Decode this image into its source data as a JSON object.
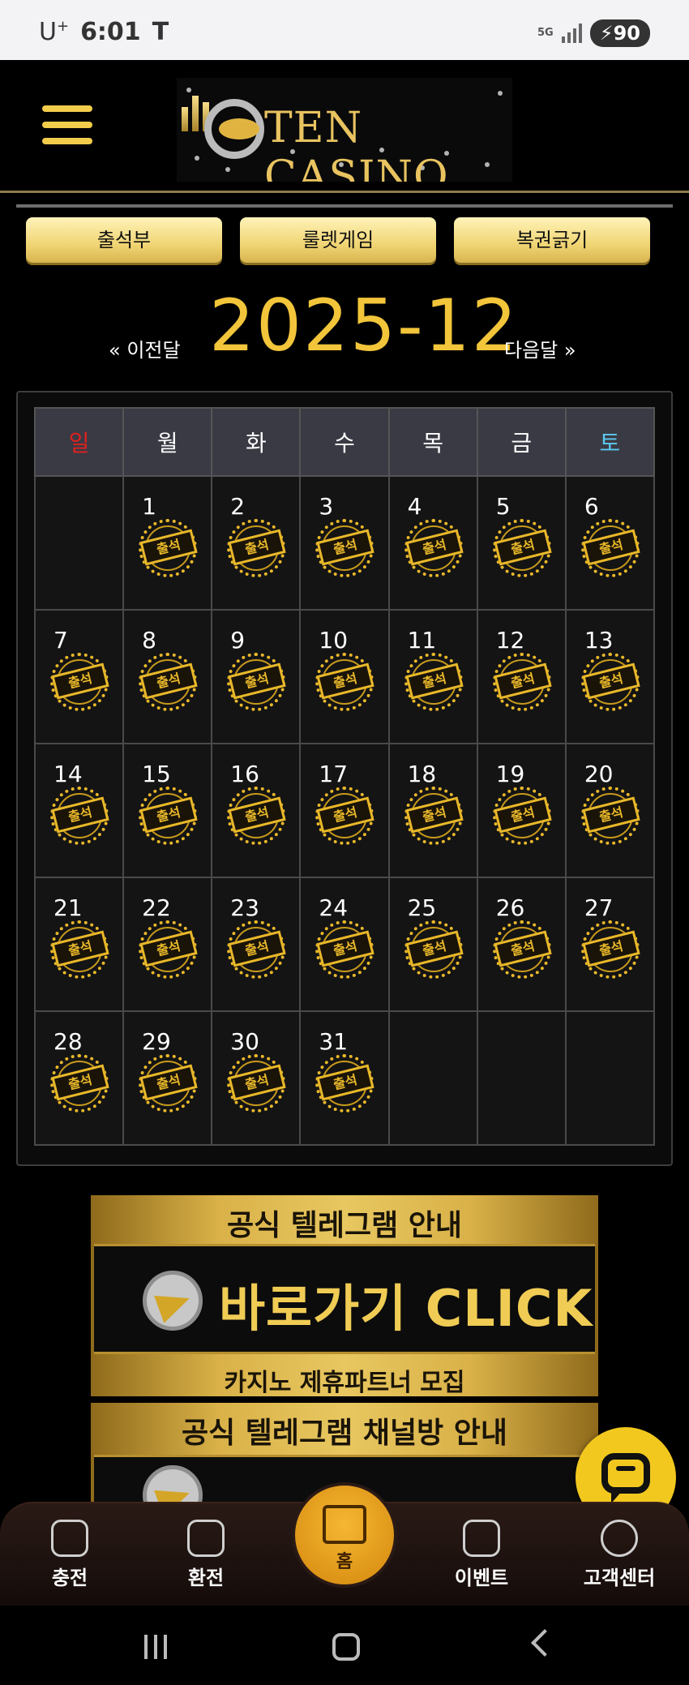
{
  "statusbar": {
    "carrier": "U",
    "carrier_sup": "+",
    "time": "6:01",
    "t_icon": "T",
    "network": "5G",
    "battery": "90"
  },
  "header": {
    "logo_text": "TEN CASINO",
    "menu_icon": "hamburger-icon"
  },
  "top_buttons": [
    "출석부",
    "룰렛게임",
    "복권긁기"
  ],
  "calendar": {
    "prev_label": "« 이전달",
    "month": "2025-12",
    "next_label": "다음달 »",
    "weekdays": [
      "일",
      "월",
      "화",
      "수",
      "목",
      "금",
      "토"
    ],
    "stamp_label": "출석",
    "weeks": [
      [
        "",
        "1",
        "2",
        "3",
        "4",
        "5",
        "6"
      ],
      [
        "7",
        "8",
        "9",
        "10",
        "11",
        "12",
        "13"
      ],
      [
        "14",
        "15",
        "16",
        "17",
        "18",
        "19",
        "20"
      ],
      [
        "21",
        "22",
        "23",
        "24",
        "25",
        "26",
        "27"
      ],
      [
        "28",
        "29",
        "30",
        "31",
        "",
        "",
        ""
      ]
    ]
  },
  "banners": [
    {
      "title": "공식 텔레그램 안내",
      "cta": "바로가기 CLICK",
      "subtitle": "카지노 제휴파트너 모집"
    },
    {
      "title": "공식 텔레그램 채널방 안내"
    }
  ],
  "bottom_nav": {
    "items": [
      "충전",
      "환전",
      "홈",
      "이벤트",
      "고객센터"
    ]
  },
  "colors": {
    "accent_gold": "#f2c53a",
    "sunday": "#e0201e",
    "saturday": "#5bc8ef",
    "home_button": "#e89f1f"
  }
}
